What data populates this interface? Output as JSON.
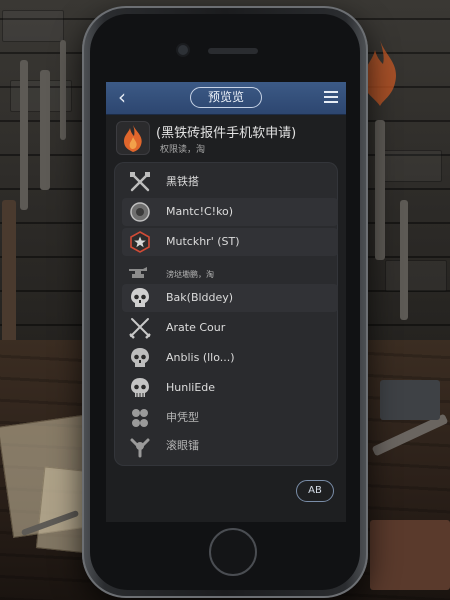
{
  "screen": {
    "title": "预览览",
    "app": {
      "name": "(黑铁砖报件手机软申请)",
      "subtitle": "权限读，淘"
    },
    "list_items": [
      {
        "label": "黑铁搭",
        "icon": "crossed-tools-icon"
      },
      {
        "label": "Mantc!C!ko)",
        "icon": "round-shield-icon"
      },
      {
        "label": "Mutckhr' (ST)",
        "icon": "star-badge-icon"
      }
    ],
    "section_label": "滂垯墈鹏，淘",
    "section_items": [
      {
        "label": "Bak(Blddey)",
        "icon": "skull-icon"
      },
      {
        "label": "Arate Cour",
        "icon": "crossed-swords-icon"
      },
      {
        "label": "Anblis (llo...)",
        "icon": "skull-icon"
      },
      {
        "label": "HunliEde",
        "icon": "skull-icon"
      },
      {
        "label": "申凭型",
        "icon": "bones-icon"
      },
      {
        "label": "滚眼镭",
        "icon": "bones-icon"
      }
    ],
    "action_button": "AB"
  },
  "colors": {
    "topbar": "#34507b",
    "accent_flame": "#e0662c",
    "screen_bg": "#1e1f21"
  }
}
